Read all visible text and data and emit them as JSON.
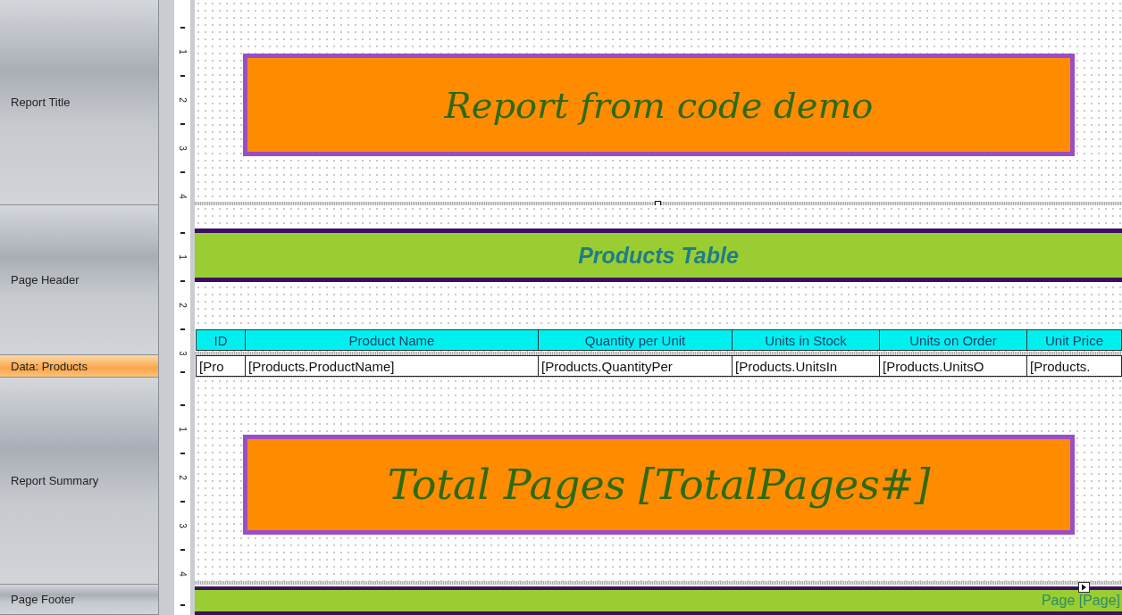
{
  "bands": [
    {
      "kind": "title",
      "label": "Report Title",
      "selected": false,
      "ruler": [
        "1",
        "2",
        "3",
        "4"
      ],
      "text": "Report from code demo"
    },
    {
      "kind": "header",
      "label": "Page Header",
      "selected": false,
      "ruler": [
        "1",
        "2",
        "3"
      ],
      "title": "Products Table",
      "columns": [
        "ID",
        "Product Name",
        "Quantity per Unit",
        "Units in Stock",
        "Units on Order",
        "Unit Price"
      ]
    },
    {
      "kind": "data",
      "label": "Data: Products",
      "selected": true,
      "cells": [
        "[Pro",
        "[Products.ProductName]",
        "[Products.QuantityPer",
        "[Products.UnitsIn",
        "[Products.UnitsO",
        "[Products."
      ]
    },
    {
      "kind": "summary",
      "label": "Report Summary",
      "selected": false,
      "ruler": [
        "1",
        "2",
        "3",
        "4"
      ],
      "text": "Total Pages [TotalPages#]"
    },
    {
      "kind": "footer",
      "label": "Page Footer",
      "selected": false,
      "text": "Page [Page]"
    }
  ]
}
